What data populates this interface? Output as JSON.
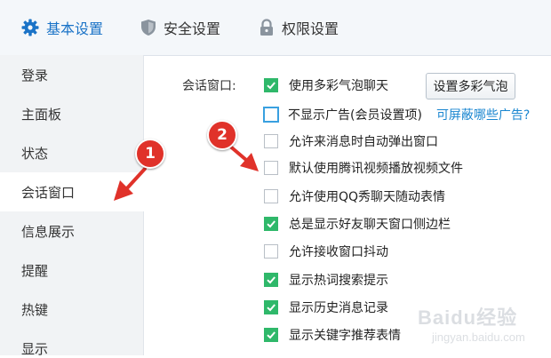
{
  "top_tabs": [
    {
      "label": "基本设置",
      "icon": "gear-icon",
      "active": true
    },
    {
      "label": "安全设置",
      "icon": "shield-icon",
      "active": false
    },
    {
      "label": "权限设置",
      "icon": "lock-icon",
      "active": false
    }
  ],
  "sidebar": {
    "items": [
      {
        "label": "登录",
        "active": false
      },
      {
        "label": "主面板",
        "active": false
      },
      {
        "label": "状态",
        "active": false
      },
      {
        "label": "会话窗口",
        "active": true
      },
      {
        "label": "信息展示",
        "active": false
      },
      {
        "label": "提醒",
        "active": false
      },
      {
        "label": "热键",
        "active": false
      },
      {
        "label": "显示",
        "active": false
      }
    ]
  },
  "section": {
    "label": "会话窗口:",
    "button_label": "设置多彩气泡",
    "link_label": "可屏蔽哪些广告?",
    "options": [
      {
        "label": "使用多彩气泡聊天",
        "checked": true
      },
      {
        "label": "不显示广告(会员设置项)",
        "checked": false
      },
      {
        "label": "允许来消息时自动弹出窗口",
        "checked": false
      },
      {
        "label": "默认使用腾讯视频播放视频文件",
        "checked": false
      },
      {
        "label": "允许使用QQ秀聊天随动表情",
        "checked": false
      },
      {
        "label": "总是显示好友聊天窗口侧边栏",
        "checked": true
      },
      {
        "label": "允许接收窗口抖动",
        "checked": false
      },
      {
        "label": "显示热词搜索提示",
        "checked": true
      },
      {
        "label": "显示历史消息记录",
        "checked": true
      },
      {
        "label": "显示关键字推荐表情",
        "checked": true
      }
    ]
  },
  "annotations": {
    "badge_1": "1",
    "badge_2": "2",
    "arrow_color": "#e0322a"
  },
  "watermark": {
    "main": "Baidu经验",
    "sub": "jingyan.baidu.com"
  },
  "colors": {
    "accent": "#1a73c7",
    "check": "#2fb86a",
    "link": "#1a86d0"
  }
}
